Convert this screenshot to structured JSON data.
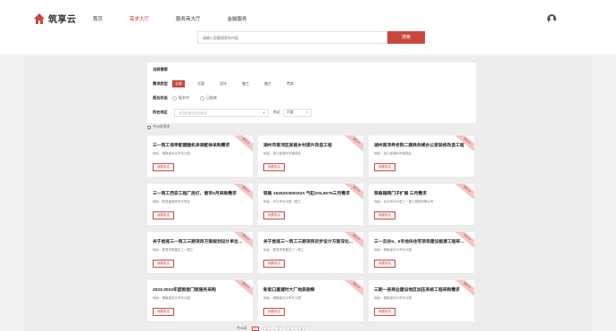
{
  "brand": {
    "name": "筑享云",
    "color": "#c9473d"
  },
  "nav": [
    {
      "label": "首页",
      "active": false
    },
    {
      "label": "需求大厅",
      "active": true
    },
    {
      "label": "服务商大厅",
      "active": false
    },
    {
      "label": "金融服务",
      "active": false
    }
  ],
  "search": {
    "placeholder": "请输入您要搜索的内容",
    "button": "搜索"
  },
  "filter": {
    "title": "当前搜索",
    "type_label": "需求类型",
    "types": [
      "全部",
      "方案",
      "设计",
      "施工",
      "施工",
      "劳务"
    ],
    "status_label": "报名状态",
    "statuses": [
      "报名中",
      "已结束"
    ],
    "region_label": "所在地区",
    "region_placeholder": "请选择需求发布地区",
    "scope_label": "附近",
    "scope_value": "不限"
  },
  "results_label": "共45条需求",
  "cards": [
    {
      "title": "三一筑工保亭配建酸机采调配体采购需求",
      "address": "地址：湖南省长沙市长沙县",
      "button": "我要报名",
      "badge": "报名中"
    },
    {
      "title": "湖州市南浔区美丽乡村提升改造工程",
      "address": "地址：浙江省湖州市南浔区",
      "button": "我要报名",
      "badge": "报名中"
    },
    {
      "title": "湖州南浔养老院二期商务楼办公室装修改造工程",
      "address": "地址：浙江省湖州市南浔区",
      "button": "我要报名",
      "badge": "报名中"
    },
    {
      "title": "三一筑工西安工程厂房灯、窗帘3月采购需求",
      "address": "地址：陕西省西安市长安区",
      "button": "我要报名",
      "badge": "报名中"
    },
    {
      "title": "铁路 1525Z0300033A 气缸DSL6075三月需求",
      "address": "地址：长沙市长沙县一国工",
      "button": "我要报名",
      "badge": "报名中"
    },
    {
      "title": "铁路箱网门子扩展 三月需求",
      "address": "地址：长沙市长沙县三一重工城投有限公司",
      "button": "我要报名",
      "badge": "报名中"
    },
    {
      "title": "关于娄底三一筑工三期项目方案规划设计单位的...",
      "address": "地址：娄底市娄星区三一筑工",
      "button": "我要报名",
      "badge": "报名中"
    },
    {
      "title": "关于娄底三一筑工三期项目初步设计方案深化...",
      "address": "地址：娄底市娄星区三一筑工",
      "button": "我要报名",
      "badge": "报名中"
    },
    {
      "title": "三一云谷5、6号地块住宅项目建设能源工程采购...",
      "address": "地址：湖南省长沙市长沙县",
      "button": "我要报名",
      "badge": "报名中"
    },
    {
      "title": "2023-2024年度智能门禁服务采购",
      "address": "地址：湖南省长沙市长沙县",
      "button": "我要报名",
      "badge": "报名中"
    },
    {
      "title": "新索口厦建时大厂地质勘察",
      "address": "地址：湖南省长沙市长沙县",
      "button": "我要报名",
      "badge": "报名中"
    },
    {
      "title": "三期一县商业建设地区加压系统工程采购需求",
      "address": "地址：湖南省长沙市长沙县",
      "button": "我要报名",
      "badge": "报名中"
    }
  ],
  "pager": {
    "label": "共45条",
    "pages": [
      "1",
      "2",
      "3",
      "4",
      "5"
    ]
  }
}
